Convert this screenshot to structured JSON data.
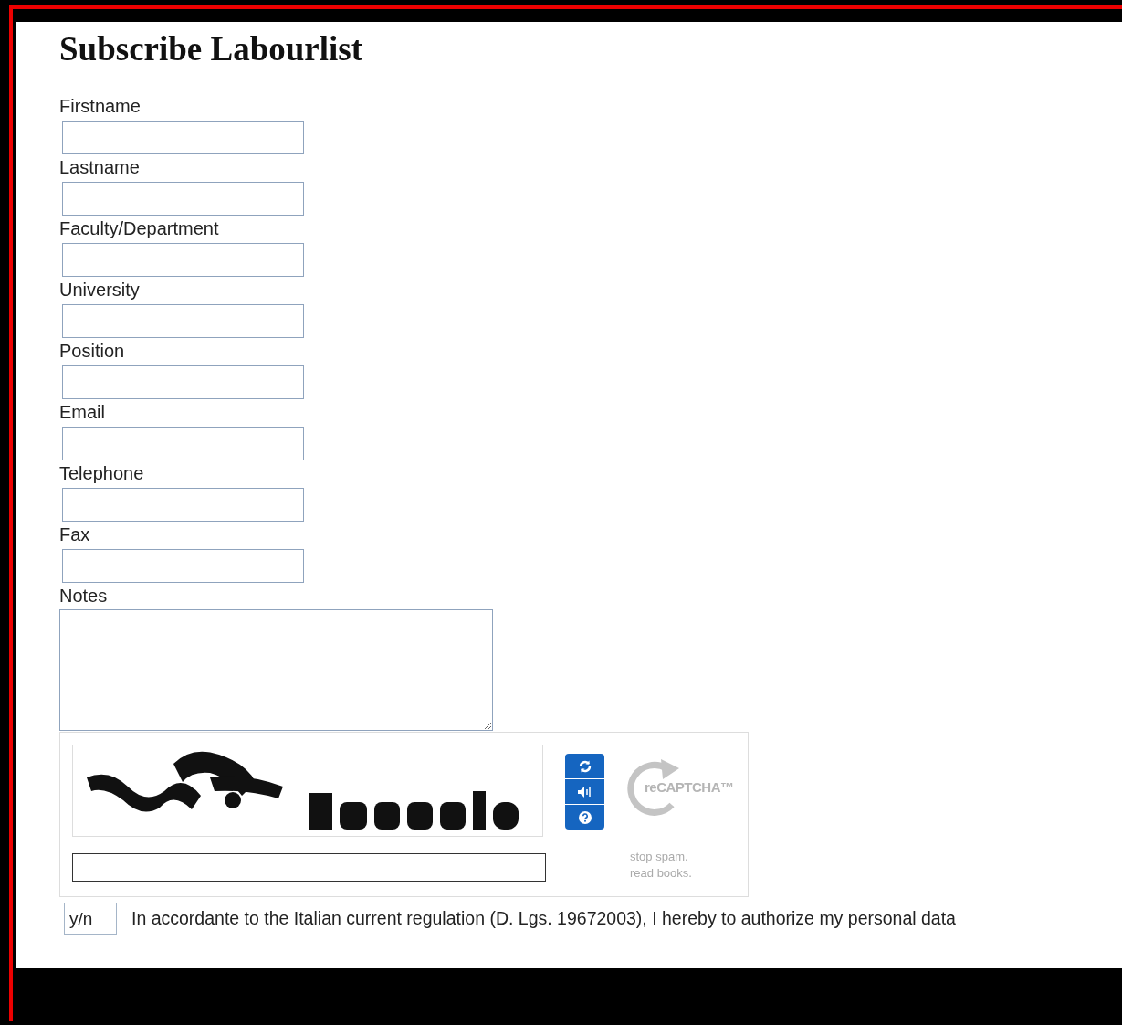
{
  "title": "Subscribe Labourlist",
  "fields": [
    {
      "label": "Firstname"
    },
    {
      "label": "Lastname"
    },
    {
      "label": "Faculty/Department"
    },
    {
      "label": "University"
    },
    {
      "label": "Position"
    },
    {
      "label": "Email"
    },
    {
      "label": "Telephone"
    },
    {
      "label": "Fax"
    }
  ],
  "notes": {
    "label": "Notes"
  },
  "captcha": {
    "logo": "reCAPTCHA™",
    "tagline": [
      "stop spam.",
      "read books."
    ]
  },
  "consent": {
    "value": "y/n",
    "text": "In accordante to the Italian current regulation (D. Lgs. 19672003), I hereby to authorize my personal data"
  }
}
